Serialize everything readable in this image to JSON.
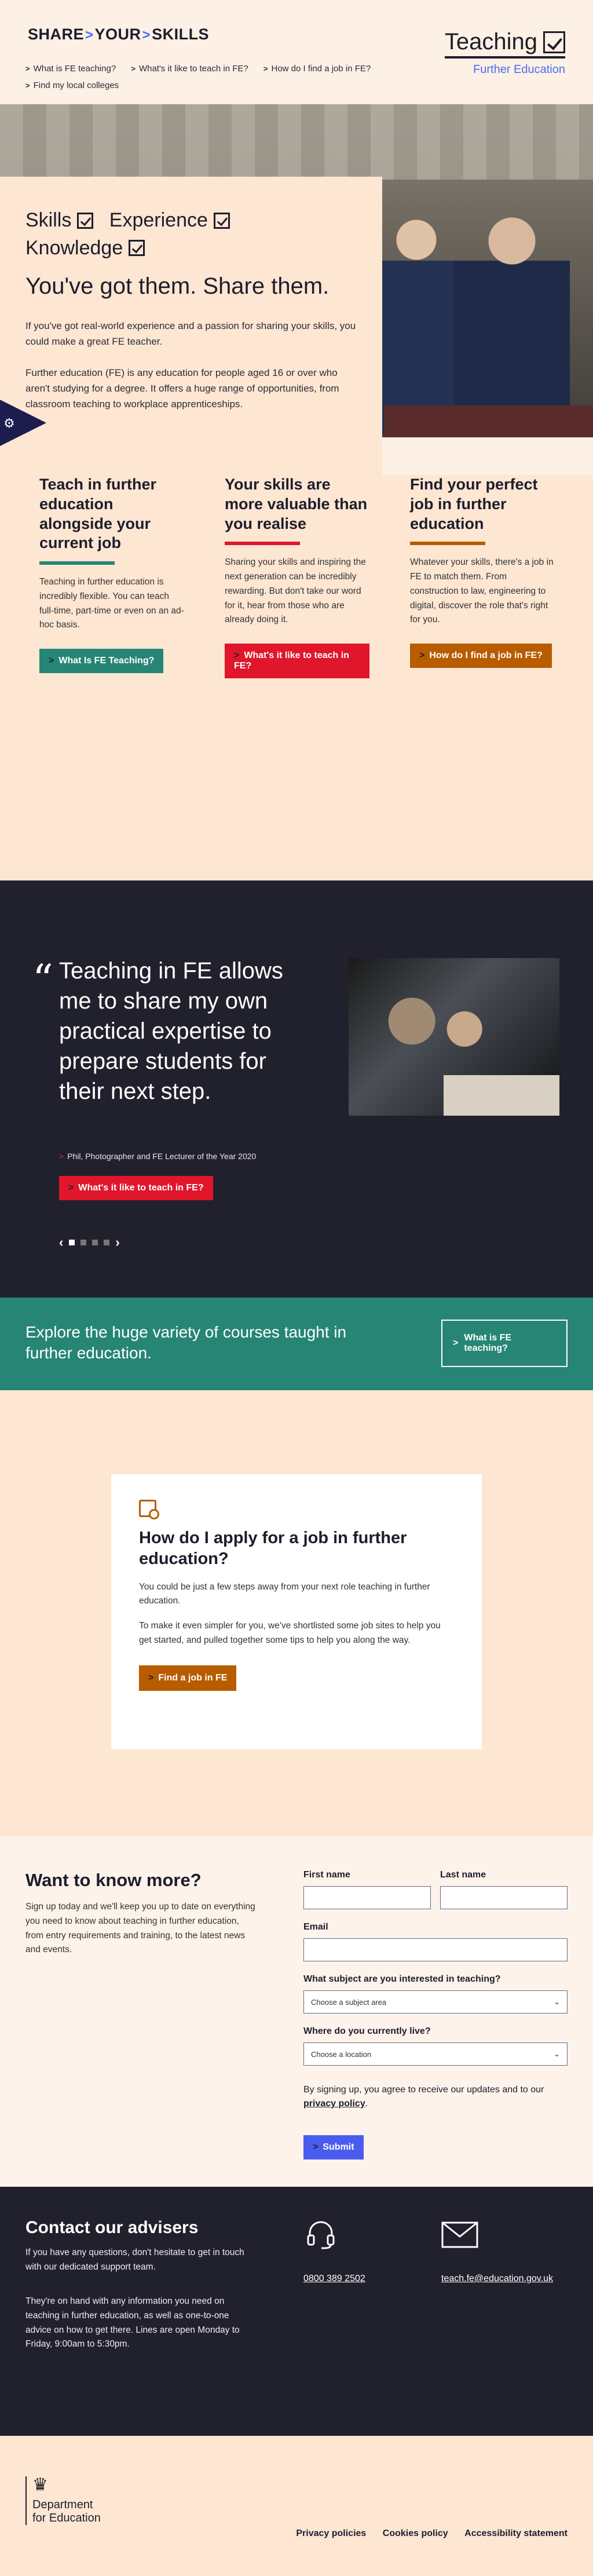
{
  "header": {
    "brand": {
      "part1": "SHARE",
      "part2": "YOUR",
      "part3": "SKILLS",
      "sep": ">"
    },
    "nav": [
      "What is FE teaching?",
      "What's it like to teach in FE?",
      "How do I find a job in FE?",
      "Find my local colleges"
    ],
    "teaching_logo": {
      "main": "Teaching",
      "sub": "Further Education"
    }
  },
  "hero": {
    "skills": [
      "Skills",
      "Experience",
      "Knowledge"
    ],
    "title": "You've got them. Share them.",
    "p1": "If you've got real-world experience and a passion for sharing your skills, you could make a great FE teacher.",
    "p2": "Further education (FE) is any education for people aged 16 or over who aren't studying for a degree. It offers a huge range of opportunities, from classroom teaching to workplace apprenticeships."
  },
  "columns": [
    {
      "title": "Teach in further education alongside your current job",
      "text": "Teaching in further education is incredibly flexible. You can teach full-time, part-time or even on an ad-hoc basis.",
      "button": "What Is FE Teaching?",
      "color": "#268575"
    },
    {
      "title": "Your skills are more valuable than you realise",
      "text": "Sharing your skills and inspiring the next generation can be incredibly rewarding. But don't take our word for it, hear from those who are already doing it.",
      "button": "What's it like to teach in FE?",
      "color": "#e0162b"
    },
    {
      "title": "Find your perfect job in further education",
      "text": "Whatever your skills, there's a job in FE to match them. From construction to law, engineering to digital, discover the role that's right for you.",
      "button": "How do I find a job in FE?",
      "color": "#b85c00"
    }
  ],
  "quote": {
    "mark": "“",
    "text": "Teaching in FE allows me to share my own practical expertise to prepare students for their next step.",
    "credit": "Phil, Photographer and FE Lecturer of the Year 2020",
    "button": "What's it like to teach in FE?",
    "slides": 4,
    "active_slide": 1
  },
  "explore": {
    "text": "Explore the huge variety of courses taught in further education.",
    "button": "What is FE teaching?"
  },
  "apply": {
    "title": "How do I apply for a job in further education?",
    "p1": "You could be just a few steps away from your next role teaching in further education.",
    "p2": "To make it even simpler for you, we've shortlisted some job sites to help you get started, and pulled together some tips to help you along the way.",
    "button": "Find a job in FE"
  },
  "signup": {
    "title": "Want to know more?",
    "text": "Sign up today and we'll keep you up to date on everything you need to know about teaching in further education, from entry requirements and training, to the latest news and events.",
    "first_name": "First name",
    "last_name": "Last name",
    "email": "Email",
    "subject_label": "What subject are you interested in teaching?",
    "subject_placeholder": "Choose a subject area",
    "location_label": "Where do you currently live?",
    "location_placeholder": "Choose a location",
    "note_pre": "By signing up, you agree to receive our updates and to our ",
    "note_link": "privacy policy",
    "note_post": ".",
    "submit": "Submit"
  },
  "contact": {
    "title": "Contact our advisers",
    "p1": "If you have any questions, don't hesitate to get in touch with our dedicated support team.",
    "p2": "They're on hand with any information you need on teaching in further education, as well as one-to-one advice on how to get there. Lines are open Monday to Friday, 9:00am to 5:30pm.",
    "phone": "0800 389 2502",
    "email": "teach.fe@education.gov.uk"
  },
  "footer": {
    "dept_line1": "Department",
    "dept_line2": "for Education",
    "links": [
      "Privacy policies",
      "Cookies policy",
      "Accessibility statement"
    ]
  },
  "colors": {
    "accent_blue": "#4a6cf7",
    "teal": "#268575",
    "red": "#e0162b",
    "orange": "#b85c00",
    "dark": "#21212d",
    "peach": "#fde6d2"
  }
}
